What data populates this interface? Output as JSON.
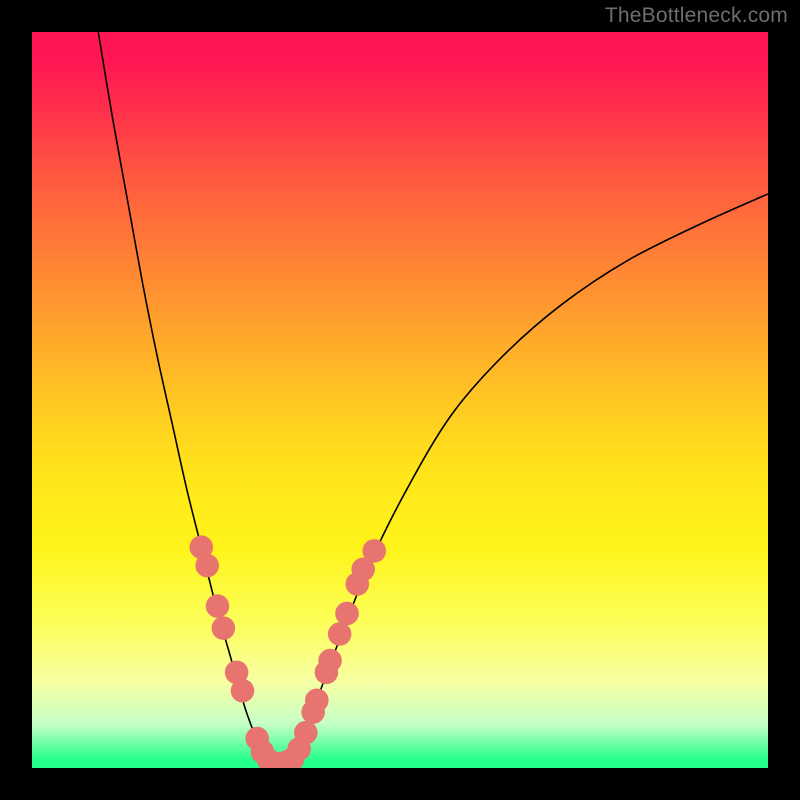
{
  "watermark": "TheBottleneck.com",
  "chart_data": {
    "type": "line",
    "title": "",
    "xlabel": "",
    "ylabel": "",
    "x_range": [
      0,
      100
    ],
    "y_range": [
      0,
      100
    ],
    "grid": false,
    "legend": false,
    "series": [
      {
        "name": "left-curve",
        "x": [
          9,
          11,
          13,
          15,
          17,
          19,
          21,
          23,
          25,
          27,
          29,
          30.5,
          31.8
        ],
        "y": [
          100,
          88,
          77,
          66,
          56,
          47,
          38,
          30,
          22,
          15,
          8,
          4,
          1.2
        ]
      },
      {
        "name": "valley-floor",
        "x": [
          31.8,
          33,
          34.2,
          35.5
        ],
        "y": [
          1.2,
          0.5,
          0.5,
          1.2
        ]
      },
      {
        "name": "right-curve",
        "x": [
          35.5,
          37,
          39,
          42,
          46,
          51,
          57,
          64,
          72,
          81,
          91,
          100
        ],
        "y": [
          1.2,
          4,
          10,
          18,
          28,
          38,
          48,
          56,
          63,
          69,
          74,
          78
        ]
      }
    ],
    "dots": {
      "name": "highlight-dots",
      "points": [
        [
          23.0,
          30.0
        ],
        [
          23.8,
          27.5
        ],
        [
          25.2,
          22.0
        ],
        [
          26.0,
          19.0
        ],
        [
          27.8,
          13.0
        ],
        [
          28.6,
          10.5
        ],
        [
          30.6,
          4.0
        ],
        [
          31.3,
          2.2
        ],
        [
          32.2,
          1.0
        ],
        [
          33.0,
          0.6
        ],
        [
          33.8,
          0.6
        ],
        [
          34.6,
          0.8
        ],
        [
          35.4,
          1.2
        ],
        [
          36.3,
          2.6
        ],
        [
          37.2,
          4.8
        ],
        [
          38.2,
          7.6
        ],
        [
          38.7,
          9.2
        ],
        [
          40.0,
          13.0
        ],
        [
          40.5,
          14.6
        ],
        [
          41.8,
          18.2
        ],
        [
          42.8,
          21.0
        ],
        [
          44.2,
          25.0
        ],
        [
          45.0,
          27.0
        ],
        [
          46.5,
          29.5
        ]
      ],
      "radius_pct": 1.6
    },
    "background_gradient": {
      "top": "#ff1753",
      "mid": "#ffe51a",
      "bottom": "#22ff8a"
    }
  }
}
